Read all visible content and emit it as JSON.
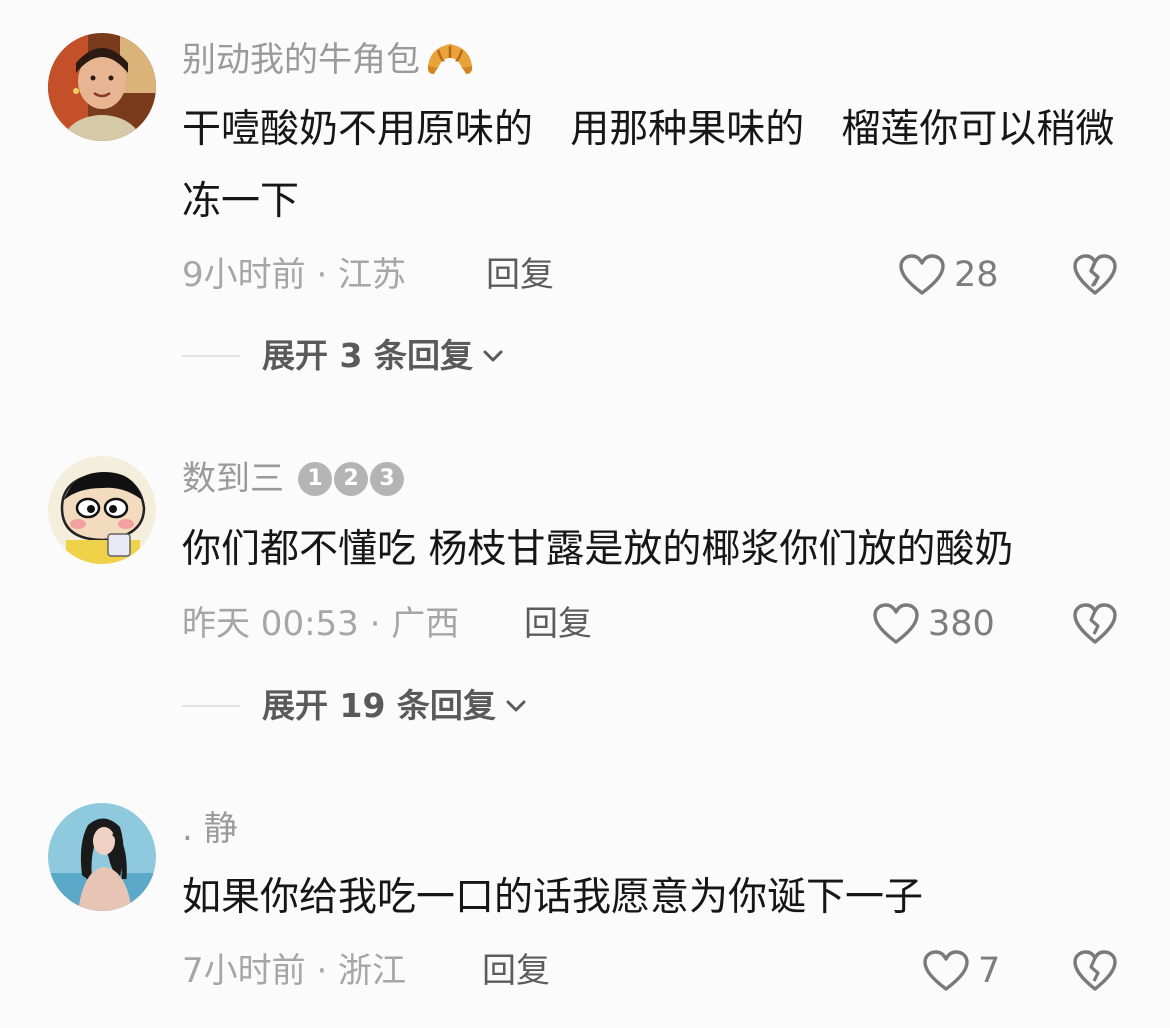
{
  "comments": [
    {
      "username": "别动我的牛角包",
      "text": "干噎酸奶不用原味的   用那种果味的   榴莲你可以稍微冻一下",
      "meta": "9小时前 · 江苏",
      "reply_label": "回复",
      "likes": "28",
      "expand_label": "展开 3 条回复"
    },
    {
      "username": "数到三",
      "badges": [
        "1",
        "2",
        "3"
      ],
      "text": "你们都不懂吃 杨枝甘露是放的椰浆你们放的酸奶",
      "meta": "昨天 00:53 · 广西",
      "reply_label": "回复",
      "likes": "380",
      "expand_label": "展开 19 条回复"
    },
    {
      "username": ". 静",
      "text": "如果你给我吃一口的话我愿意为你诞下一子",
      "meta": "7小时前 · 浙江",
      "reply_label": "回复",
      "likes": "7"
    }
  ],
  "icons": {
    "like": "heart-outline-icon",
    "dislike": "broken-heart-icon",
    "expand": "chevron-down-icon",
    "emoji": "croissant-icon"
  },
  "colors": {
    "background": "#fbfbfb",
    "text": "#161616",
    "muted": "#a6a6a6"
  }
}
